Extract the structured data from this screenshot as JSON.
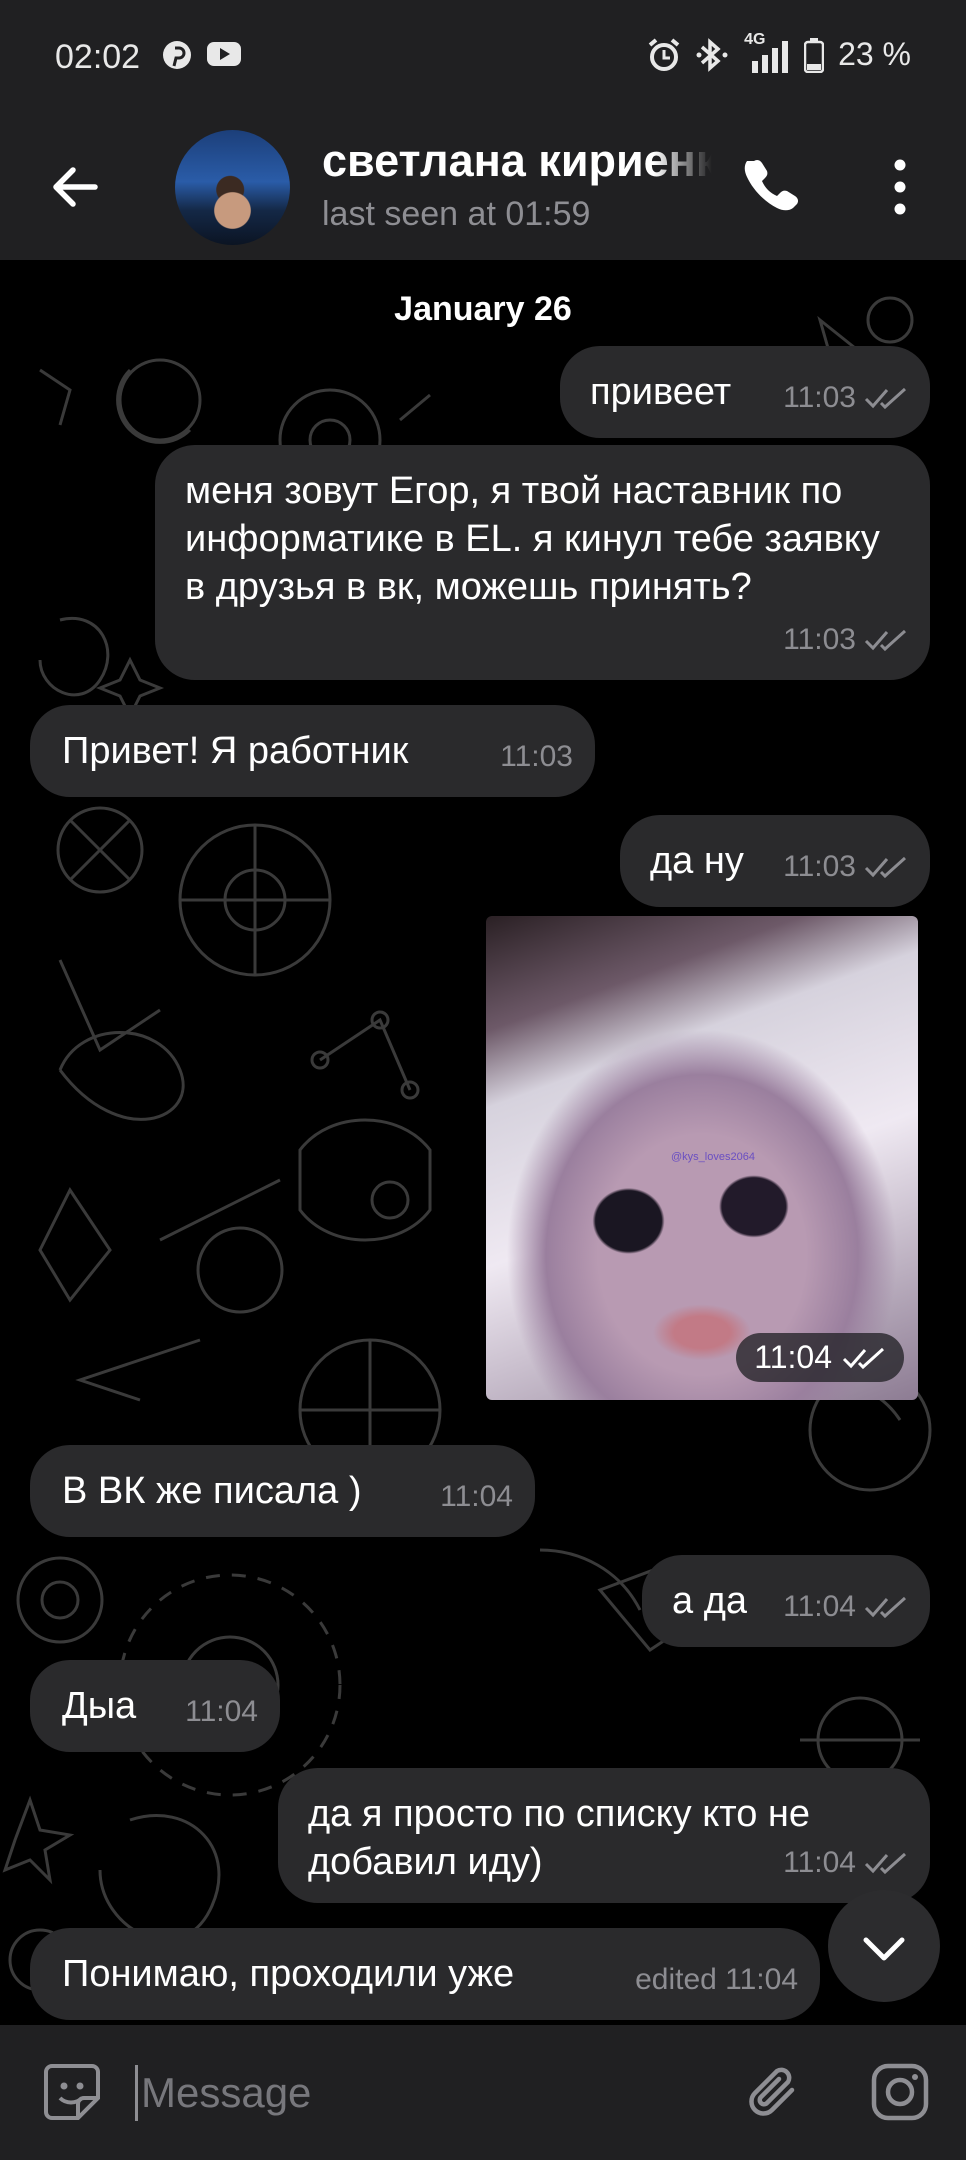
{
  "status_bar": {
    "time": "02:02",
    "network": "4G",
    "battery": "23 %",
    "icons": [
      "pinterest-icon",
      "youtube-icon",
      "alarm-icon",
      "bluetooth-icon",
      "signal-icon",
      "battery-icon"
    ]
  },
  "header": {
    "contact_name": "светлана кириенко",
    "last_seen": "last seen at 01:59"
  },
  "chat": {
    "date": "January 26",
    "messages": [
      {
        "direction": "out",
        "text": "привеет",
        "time": "11:03",
        "status": "read"
      },
      {
        "direction": "out",
        "text": "меня зовут Егор, я твой наставник по информатике в EL. я кинул тебе заявку в друзья в вк, можешь принять?",
        "time": "11:03",
        "status": "read"
      },
      {
        "direction": "in",
        "text": "Привет! Я работник",
        "time": "11:03"
      },
      {
        "direction": "out",
        "text": "да ну",
        "time": "11:03",
        "status": "read"
      },
      {
        "direction": "out",
        "type": "photo",
        "photo_text": "@kys_loves2064",
        "time": "11:04",
        "status": "read"
      },
      {
        "direction": "in",
        "text": "В ВК же писала )",
        "time": "11:04"
      },
      {
        "direction": "out",
        "text": "а да",
        "time": "11:04",
        "status": "read"
      },
      {
        "direction": "in",
        "text": "Дыа",
        "time": "11:04"
      },
      {
        "direction": "out",
        "text": "да я просто по списку кто не добавил иду)",
        "time": "11:04",
        "status": "read"
      },
      {
        "direction": "in",
        "text": "Понимаю, проходили уже",
        "time": "edited 11:04"
      }
    ]
  },
  "input": {
    "placeholder": "Message"
  },
  "colors": {
    "bars": "#202022",
    "bubble": "#2a2a2c",
    "background": "#000000",
    "meta_text": "#8d8d92"
  }
}
